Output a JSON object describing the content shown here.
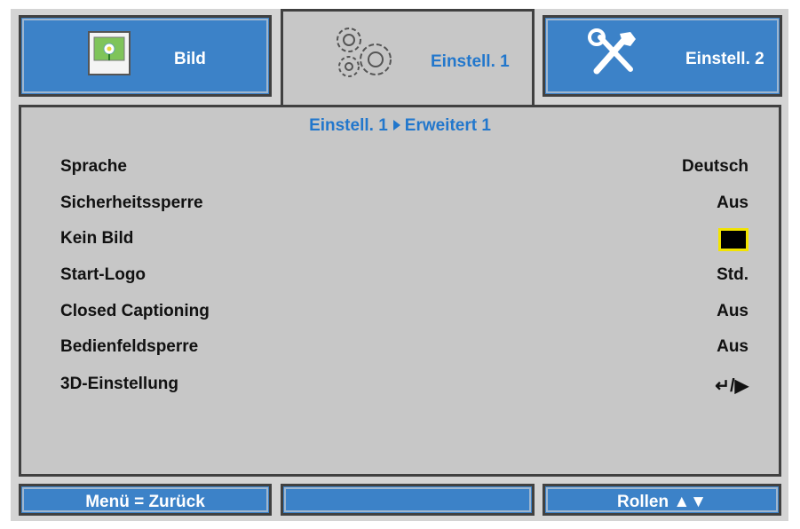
{
  "tabs": [
    {
      "label": "Bild",
      "icon": "picture-icon",
      "active": false
    },
    {
      "label": "Einstell. 1",
      "icon": "gears-icon",
      "active": true
    },
    {
      "label": "Einstell. 2",
      "icon": "tools-icon",
      "active": false
    }
  ],
  "breadcrumb": {
    "parent": "Einstell. 1",
    "current": "Erweitert 1"
  },
  "menu": [
    {
      "label": "Sprache",
      "value": "Deutsch"
    },
    {
      "label": "Sicherheitssperre",
      "value": "Aus"
    },
    {
      "label": "Kein Bild",
      "value_type": "color-swatch",
      "swatch_color": "#000000"
    },
    {
      "label": "Start-Logo",
      "value": "Std."
    },
    {
      "label": "Closed Captioning",
      "value": "Aus"
    },
    {
      "label": "Bedienfeldsperre",
      "value": "Aus"
    },
    {
      "label": "3D-Einstellung",
      "value": "↵/▶"
    }
  ],
  "footer": {
    "left": "Menü = Zurück",
    "middle": "",
    "right": "Rollen ▲▼"
  },
  "colors": {
    "tab_blue": "#3c82c8",
    "accent_blue": "#2277cc",
    "panel_gray": "#c7c7c7",
    "highlight": "#f2e400"
  }
}
